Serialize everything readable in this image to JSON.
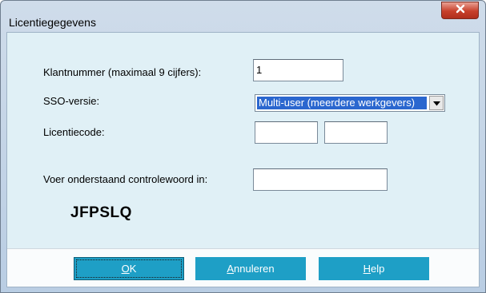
{
  "window": {
    "title": "Licentiegegevens"
  },
  "form": {
    "customer_number_label": "Klantnummer (maximaal 9 cijfers):",
    "customer_number_value": "1",
    "sso_version_label": "SSO-versie:",
    "sso_version_selected": "Multi-user (meerdere werkgevers)",
    "license_code_label": "Licentiecode:",
    "license_code_part1": "",
    "license_code_part2": "",
    "control_word_label": "Voer onderstaand controlewoord in:",
    "control_word_value": "",
    "captcha_text": "JFPSLQ"
  },
  "buttons": {
    "ok_mnemonic": "O",
    "ok_rest": "K",
    "cancel_mnemonic": "A",
    "cancel_rest": "nnuleren",
    "help_mnemonic": "H",
    "help_rest": "elp"
  },
  "colors": {
    "client_background": "#e0f0f6",
    "button": "#1e9fc6",
    "close_button": "#c7402b",
    "selection": "#2b67cf"
  },
  "icons": {
    "close": "close-icon",
    "dropdown": "chevron-down-icon"
  }
}
